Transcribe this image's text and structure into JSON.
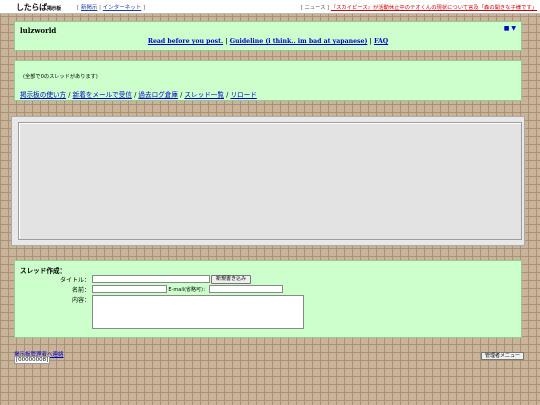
{
  "topbar": {
    "logo_main": "したらば",
    "logo_sub": "掲示板",
    "sep1": "[",
    "search_link": "新掲示",
    "sep2": "|",
    "internet_link": "インターネット",
    "sep3": "]",
    "news_prefix": "[ ニュース ]",
    "news_link": "『スカイピース』が活動休止中のテオくんの現状について言及「森の開きな子様です」"
  },
  "header": {
    "board_title": "lulzworld",
    "nav_icons": "■ ▼",
    "link_read_before": "Read before you post.",
    "sep": "|",
    "link_guideline": "Guideline (i think.. im bad at yapanese)",
    "link_faq": "FAQ"
  },
  "menu": {
    "thread_count": "(全部で0のスレッドがあります)",
    "links": [
      "掲示板の使い方",
      "新着をメールで受信",
      "過去ログ倉庫",
      "スレッド一覧",
      "リロード"
    ],
    "sep": "/"
  },
  "thread_form": {
    "title": "スレッド作成：",
    "label_title": "タイトル：",
    "label_name": "名前：",
    "label_email": "E-mail(省略可)：",
    "label_content": "内容：",
    "submit_label": "新規書き込み",
    "title_value": "",
    "name_value": "",
    "email_value": "",
    "content_value": ""
  },
  "footer": {
    "contact_link": "掲示板管理者へ連絡",
    "counter": "[00000008]",
    "admin_button": "管理者メニュー"
  }
}
